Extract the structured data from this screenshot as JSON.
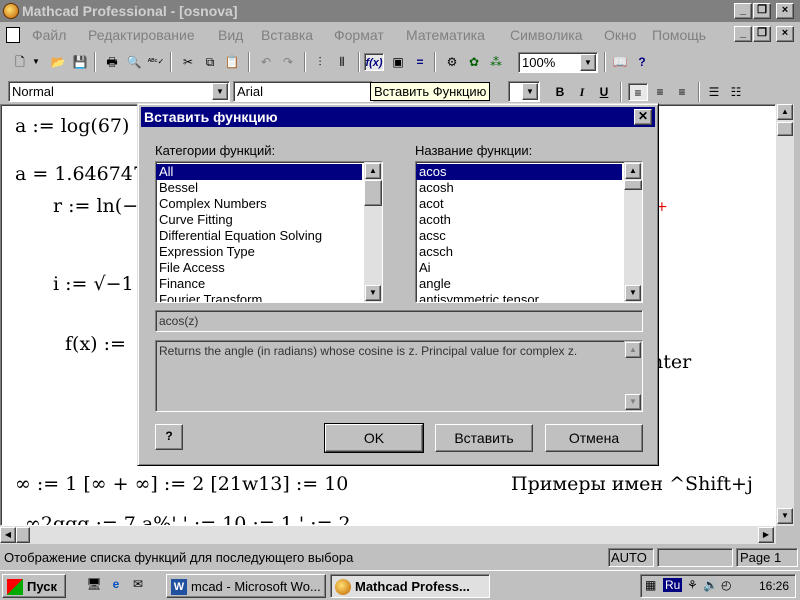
{
  "window": {
    "title": "Mathcad Professional - [osnova]"
  },
  "menu": [
    "Файл",
    "Редактирование",
    "Вид",
    "Вставка",
    "Формат",
    "Математика",
    "Символика",
    "Окно",
    "Помощь"
  ],
  "toolbar": {
    "zoom": "100%",
    "style": "Normal",
    "font": "Arial"
  },
  "tooltip": "Вставить Функцию",
  "worksheet": {
    "lines": [
      {
        "text": "a := log(67)"
      },
      {
        "text": "a = 1.646747"
      },
      {
        "text": "r := ln(−"
      },
      {
        "text": "i := √−1"
      },
      {
        "text": "f(x) :="
      },
      {
        "text": "nter"
      },
      {
        "text": "∞ := 1      [∞ + ∞] := 2     [21w13] := 10"
      },
      {
        "text": "Примеры имен  ^Shift+j"
      },
      {
        "text": "∞2qqq := 7  a%' ' := 10     := 1  ' := 2"
      }
    ]
  },
  "dialog": {
    "title": "Вставить функцию",
    "categories_label": "Категории функций:",
    "functions_label": "Название функции:",
    "categories": [
      "All",
      "Bessel",
      "Complex Numbers",
      "Curve Fitting",
      "Differential Equation Solving",
      "Expression Type",
      "File Access",
      "Finance",
      "Fourier Transform"
    ],
    "selected_category": "All",
    "functions": [
      "acos",
      "acosh",
      "acot",
      "acoth",
      "acsc",
      "acsch",
      "Ai",
      "angle",
      "antisymmetric tensor"
    ],
    "selected_function": "acos",
    "signature": "acos(z)",
    "description": "Returns the angle (in radians) whose cosine is z. Principal value for complex z.",
    "ok_label": "OK",
    "insert_label": "Вставить",
    "cancel_label": "Отмена"
  },
  "statusbar": {
    "hint": "Отображение списка функций для последующего выбора",
    "mode": "AUTO",
    "page": "Page 1"
  },
  "taskbar": {
    "start": "Пуск",
    "tasks": [
      "mcad - Microsoft Wo...",
      "Mathcad Profess..."
    ],
    "lang": "Ru",
    "time": "16:26"
  },
  "colors": {
    "title_active": "#000080",
    "title_inactive": "#808080",
    "face": "#c0c0c0",
    "tooltip_bg": "#ffffe1"
  }
}
